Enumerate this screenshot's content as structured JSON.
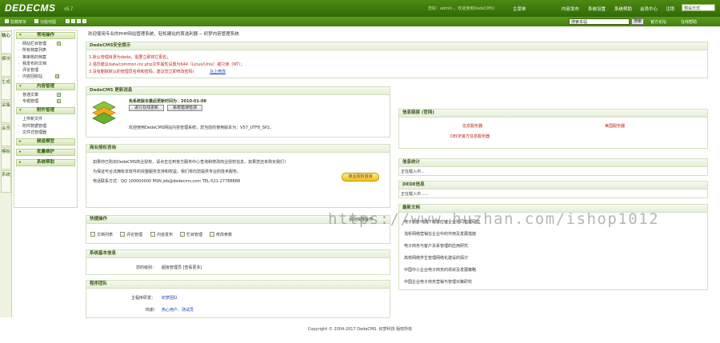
{
  "header": {
    "logo": "DEDECMS",
    "version": "v5.7",
    "user_info": "您好：admin ，欢迎使用DedeCMS！",
    "nav": [
      "主菜单",
      "内容发布",
      "系统设置",
      "系统帮助",
      "会员中心",
      "注销"
    ],
    "style_select": "预设方式"
  },
  "subbar": {
    "items": [
      "隐藏菜单",
      "功能地图"
    ],
    "search": {
      "value": "搜索本站",
      "button": "搜索"
    },
    "links": [
      "官方论坛",
      "在线帮助"
    ]
  },
  "tabs": [
    "核心",
    "模块",
    "生成",
    "采集",
    "会员",
    "模板",
    "系统"
  ],
  "menu": {
    "sections": [
      {
        "title": "常用操作",
        "items": [
          "网站栏目管理",
          "所有档案列表",
          "等审核的档案",
          "我发布的文档",
          "评论管理",
          "内容回收站"
        ]
      },
      {
        "title": "内容管理",
        "items": [
          "普通文章",
          "专题管理"
        ]
      },
      {
        "title": "附件管理",
        "items": [
          "上传新文件",
          "附件数据管理",
          "文件式管理器"
        ]
      },
      {
        "title": "频道模型"
      },
      {
        "title": "批量维护"
      },
      {
        "title": "系统帮助"
      }
    ]
  },
  "greeting": "欢迎使用专业的PHP网站管理系统，轻松建站的首选利器 -- 织梦内容管理系统",
  "security": {
    "title": "DedeCMS安全提示",
    "lines": [
      "1.默认管理目录为dede，需要立即将它更名；",
      "2.强烈建议data/common.inc.php文件属性设置为644（Linux/Unix）或只读（NT）；",
      "3.没有删除默认的管理员名称和密码，建议您立即修改密码！"
    ],
    "link": "马上修改"
  },
  "update": {
    "title": "DedeCMS 更新消息",
    "time": "免系统版本最后更新时间为：2010-01-08",
    "buttons": [
      "进行在线更新",
      "系统错误检测"
    ],
    "message": "欢迎使用DedeCMS网站内容管理系统，您当前的使用版本为：V57_UTF8_SP2。"
  },
  "license": {
    "title": "商业授权咨询",
    "lines": [
      "如果你已购买DedeCMS商业授权，请点击在到官方服务中心查询和修改商业授权信息，如果您还未购买我们！",
      "为保证可合法拥有本软件的完整服务支持和权益。我们将向您提供专业的技术服务。",
      "电话联系方式：QQ 100000000 MSN job@dedecms.com TEL:021-27788888"
    ],
    "button": "商业授权咨询"
  },
  "quick": {
    "title": "快捷操作",
    "items": [
      "文档列表",
      "评论管理",
      "内容发布",
      "栏目管理",
      "修改参数"
    ],
    "add": "添加快捷操作"
  },
  "sysinfo": {
    "title": "系统基本信息",
    "label": "您的级别：",
    "value": "超级管理员 [查看更多]"
  },
  "team": {
    "title": "程序团队",
    "rows": [
      {
        "label": "主程序研发：",
        "value": "织梦团队"
      },
      {
        "label": "鸣谢：",
        "value": "热心用户、测试员"
      }
    ]
  },
  "links": {
    "title": "信息链接 (官网)",
    "items": [
      "信息服务器",
      "美国服务器",
      "DEDE官方信息服务器"
    ]
  },
  "stats": {
    "title": "信息统计",
    "text": "正在载入中..."
  },
  "dede": {
    "title": "DEDE信息",
    "text": "正在载入中......"
  },
  "news": {
    "title": "最新文档",
    "items": [
      "电子商务环境下的供应链企业协同管理研究",
      "浅析网络营销在企业中的作用及发展措施",
      "电子商务与客户关系管理的应用研究",
      "高校网络学生管理网络化建设的探讨",
      "中国中小企业电子商务的现状及发展策略",
      "中国企业电子商务营销与管理对策研究"
    ]
  },
  "footer": "Copyright © 2004-2017 DedeCMS. 织梦科技 版权所有",
  "watermark": "https://www.huzhan.com/ishop1012"
}
